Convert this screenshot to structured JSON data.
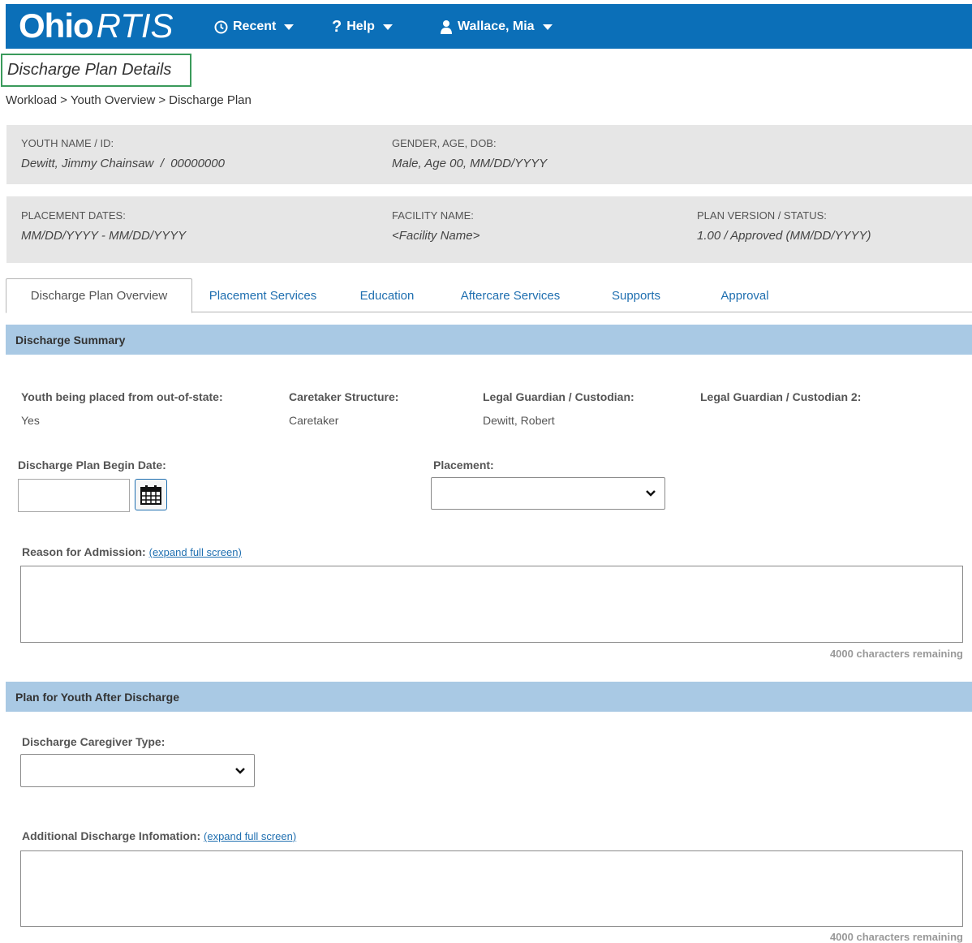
{
  "app": {
    "logo_main": "Ohio",
    "logo_italic": "RTIS"
  },
  "nav": {
    "recent": "Recent",
    "help": "Help",
    "user": "Wallace, Mia"
  },
  "page": {
    "title": "Discharge Plan Details",
    "breadcrumb": [
      "Workload",
      "Youth Overview",
      "Discharge Plan"
    ],
    "breadcrumb_sep": ">"
  },
  "youth": {
    "name_label": "YOUTH NAME / ID:",
    "name_value": "Dewitt, Jimmy Chainsaw  /  00000000",
    "gender_label": "GENDER, AGE, DOB:",
    "gender_value": "Male, Age 00, MM/DD/YYYY",
    "placement_label": "PLACEMENT DATES:",
    "placement_value": "MM/DD/YYYY - MM/DD/YYYY",
    "facility_label": "FACILITY NAME:",
    "facility_value": "<Facility Name>",
    "plan_label": "PLAN VERSION / STATUS:",
    "plan_value": "1.00 / Approved (MM/DD/YYYY)"
  },
  "tabs": [
    {
      "label": "Discharge Plan Overview",
      "active": true
    },
    {
      "label": "Placement Services",
      "active": false
    },
    {
      "label": "Education",
      "active": false
    },
    {
      "label": "Aftercare Services",
      "active": false
    },
    {
      "label": "Supports",
      "active": false
    },
    {
      "label": "Approval",
      "active": false
    }
  ],
  "discharge_summary": {
    "heading": "Discharge Summary",
    "out_of_state_label": "Youth being placed from out-of-state:",
    "out_of_state_value": "Yes",
    "caretaker_label": "Caretaker Structure:",
    "caretaker_value": "Caretaker",
    "guardian_label": "Legal Guardian / Custodian:",
    "guardian_value": "Dewitt, Robert",
    "guardian2_label": "Legal Guardian / Custodian 2:",
    "begin_date_label": "Discharge Plan Begin Date:",
    "begin_date_value": "",
    "placement_label": "Placement:",
    "placement_value": "",
    "reason_label": "Reason for Admission:",
    "expand_link": "(expand full screen)",
    "reason_value": "",
    "chars_remaining": "4000 characters remaining"
  },
  "plan_after": {
    "heading": "Plan for Youth After Discharge",
    "caregiver_label": "Discharge Caregiver Type:",
    "caregiver_value": "",
    "additional_label": "Additional Discharge Infomation:",
    "expand_link": "(expand full screen)",
    "additional_value": "",
    "chars_remaining": "4000 characters remaining"
  },
  "colors": {
    "topbar": "#0b6fb8",
    "section_bar": "#a9c9e4",
    "panel": "#e6e6e6",
    "link": "#1f6fb0",
    "title_border": "#3a9a5b"
  }
}
